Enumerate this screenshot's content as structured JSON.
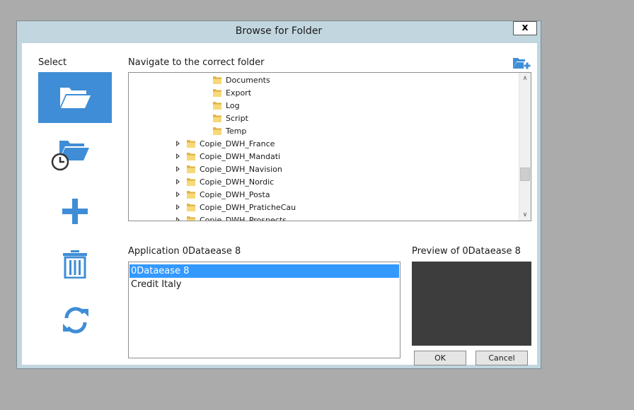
{
  "window": {
    "title": "Browse for Folder",
    "close_label": "x"
  },
  "sidebar": {
    "title": "Select",
    "items": [
      {
        "name": "browse",
        "icon": "folder-open-icon",
        "active": true
      },
      {
        "name": "recent",
        "icon": "folder-recent-icon",
        "active": false
      },
      {
        "name": "add",
        "icon": "plus-icon",
        "active": false
      },
      {
        "name": "delete",
        "icon": "trash-icon",
        "active": false
      },
      {
        "name": "refresh",
        "icon": "refresh-icon",
        "active": false
      }
    ]
  },
  "navigate": {
    "label": "Navigate to the correct folder",
    "new_folder_icon": "new-folder-icon",
    "tree": [
      {
        "label": "Documents",
        "expandable": false,
        "level": 2
      },
      {
        "label": "Export",
        "expandable": false,
        "level": 2
      },
      {
        "label": "Log",
        "expandable": false,
        "level": 2
      },
      {
        "label": "Script",
        "expandable": false,
        "level": 2
      },
      {
        "label": "Temp",
        "expandable": false,
        "level": 2
      },
      {
        "label": "Copie_DWH_France",
        "expandable": true,
        "level": 1
      },
      {
        "label": "Copie_DWH_Mandati",
        "expandable": true,
        "level": 1
      },
      {
        "label": "Copie_DWH_Navision",
        "expandable": true,
        "level": 1
      },
      {
        "label": "Copie_DWH_Nordic",
        "expandable": true,
        "level": 1
      },
      {
        "label": "Copie_DWH_Posta",
        "expandable": true,
        "level": 1
      },
      {
        "label": "Copie_DWH_PraticheCau",
        "expandable": true,
        "level": 1
      },
      {
        "label": "Copie_DWH_Prospects",
        "expandable": true,
        "level": 1
      }
    ]
  },
  "application": {
    "label": "Application 0Dataease 8",
    "items": [
      {
        "label": "0Dataease 8",
        "selected": true
      },
      {
        "label": "Credit Italy",
        "selected": false
      }
    ]
  },
  "preview": {
    "label": "Preview of 0Dataease 8"
  },
  "buttons": {
    "ok": "OK",
    "cancel": "Cancel"
  },
  "colors": {
    "accent": "#3f8dd6",
    "selection": "#3399ff",
    "frame": "#c1d6df",
    "preview_bg": "#3d3d3d"
  }
}
